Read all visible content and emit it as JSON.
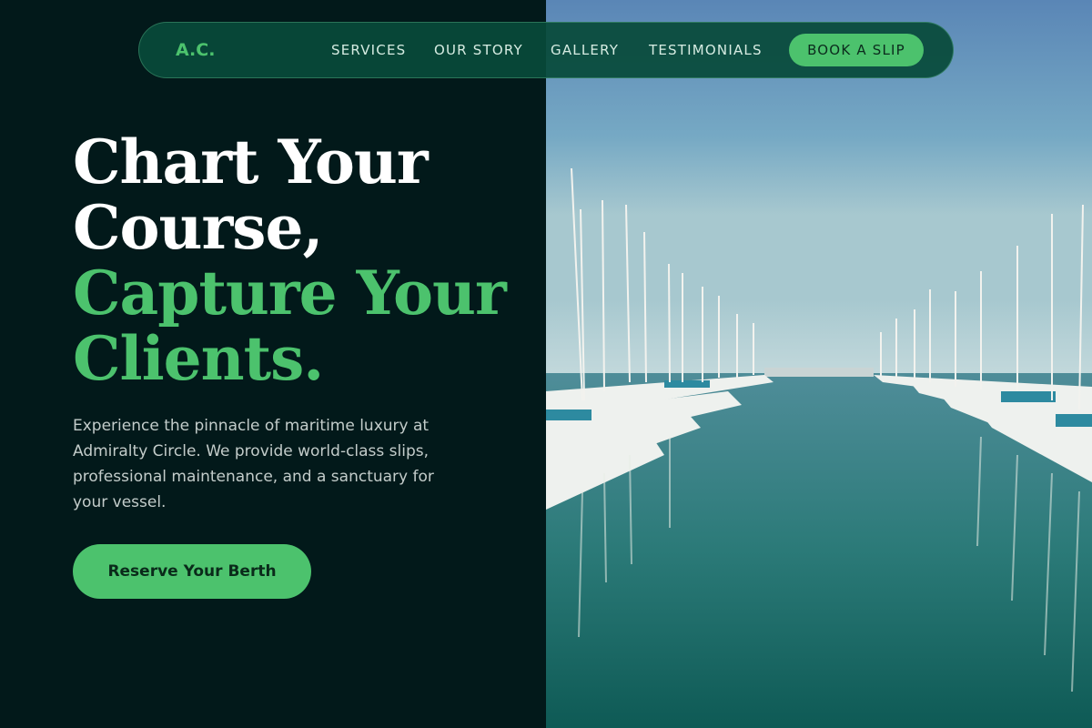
{
  "brand": {
    "logo": "A.C."
  },
  "nav": {
    "links": [
      "SERVICES",
      "OUR STORY",
      "GALLERY",
      "TESTIMONIALS"
    ],
    "cta": "BOOK A SLIP"
  },
  "hero": {
    "line1": "Chart Your",
    "line2": "Course,",
    "line3": "Capture Your",
    "line4": "Clients.",
    "description": "Experience the pinnacle of maritime luxury at Admiralty Circle. We provide world-class slips, professional maintenance, and a sanctuary for your vessel.",
    "cta": "Reserve Your Berth"
  },
  "image": {
    "subject": "marina-photo"
  },
  "colors": {
    "accent": "#4cc26d",
    "background": "#02191a",
    "nav": "#084a3a"
  }
}
